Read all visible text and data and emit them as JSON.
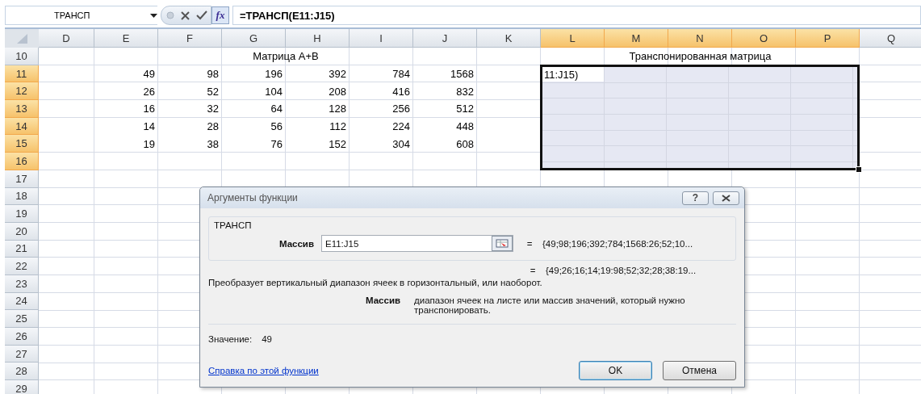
{
  "formula_bar": {
    "name_box": "ТРАНСП",
    "function_label": "fx",
    "formula": "=ТРАНСП(E11:J15)"
  },
  "columns": [
    {
      "label": "D",
      "selected": false
    },
    {
      "label": "E",
      "selected": false
    },
    {
      "label": "F",
      "selected": false
    },
    {
      "label": "G",
      "selected": false
    },
    {
      "label": "H",
      "selected": false
    },
    {
      "label": "I",
      "selected": false
    },
    {
      "label": "J",
      "selected": false
    },
    {
      "label": "K",
      "selected": false
    },
    {
      "label": "L",
      "selected": true
    },
    {
      "label": "M",
      "selected": true
    },
    {
      "label": "N",
      "selected": true
    },
    {
      "label": "O",
      "selected": true
    },
    {
      "label": "P",
      "selected": true
    },
    {
      "label": "Q",
      "selected": false
    }
  ],
  "rows": [
    {
      "label": "10",
      "selected": false,
      "titles": [
        "Матрица А+В",
        "Транспонированная матрица"
      ]
    },
    {
      "label": "11",
      "selected": true,
      "values": [
        "49",
        "98",
        "196",
        "392",
        "784",
        "1568"
      ],
      "editor": "11:J15)"
    },
    {
      "label": "12",
      "selected": true,
      "values": [
        "26",
        "52",
        "104",
        "208",
        "416",
        "832"
      ]
    },
    {
      "label": "13",
      "selected": true,
      "values": [
        "16",
        "32",
        "64",
        "128",
        "256",
        "512"
      ]
    },
    {
      "label": "14",
      "selected": true,
      "values": [
        "14",
        "28",
        "56",
        "112",
        "224",
        "448"
      ]
    },
    {
      "label": "15",
      "selected": true,
      "values": [
        "19",
        "38",
        "76",
        "152",
        "304",
        "608"
      ]
    },
    {
      "label": "16",
      "selected": true
    },
    {
      "label": "17",
      "selected": false
    },
    {
      "label": "18",
      "selected": false
    },
    {
      "label": "19",
      "selected": false
    },
    {
      "label": "20",
      "selected": false
    },
    {
      "label": "21",
      "selected": false
    },
    {
      "label": "22",
      "selected": false
    },
    {
      "label": "23",
      "selected": false
    },
    {
      "label": "24",
      "selected": false
    },
    {
      "label": "25",
      "selected": false
    },
    {
      "label": "26",
      "selected": false
    },
    {
      "label": "27",
      "selected": false
    },
    {
      "label": "28",
      "selected": false
    },
    {
      "label": "29",
      "selected": false
    }
  ],
  "dialog": {
    "title": "Аргументы функции",
    "help_button": "?",
    "function_name": "ТРАНСП",
    "argument": {
      "label": "Массив",
      "value": "E11:J15",
      "result_sign": "=",
      "result": "{49;98;196;392;784;1568:26;52;10..."
    },
    "function_result_sign": "=",
    "function_result": "{49;26;16;14;19:98;52;32;28;38:19...",
    "description": "Преобразует вертикальный диапазон ячеек в горизонтальный, или наоборот.",
    "argument_help": {
      "label": "Массив",
      "text": "диапазон ячеек на листе или массив значений, который нужно транспонировать."
    },
    "value_label": "Значение:",
    "value": "49",
    "help_link": "Справка по этой функции",
    "buttons": [
      {
        "label": "OK",
        "default": true
      },
      {
        "label": "Отмена",
        "default": false
      }
    ]
  }
}
